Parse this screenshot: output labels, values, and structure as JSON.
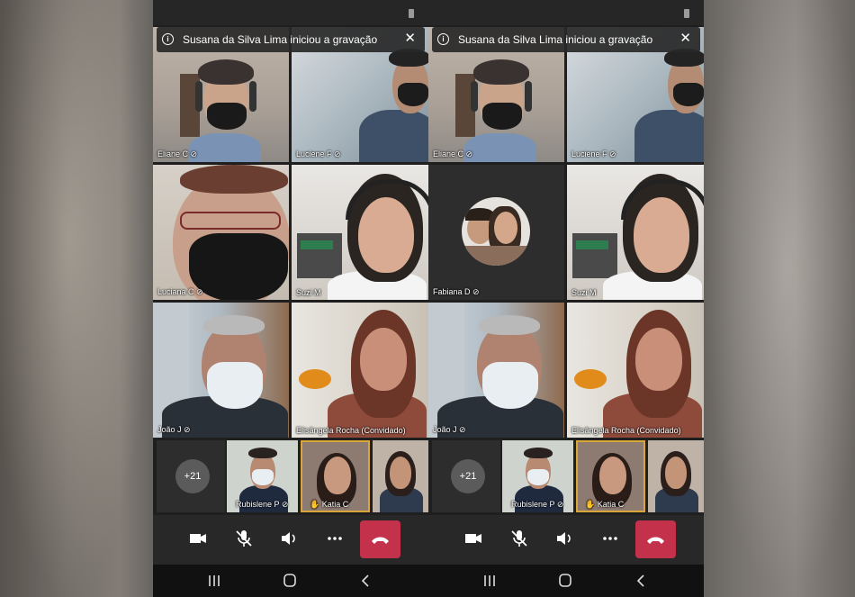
{
  "notice": "Susana da Silva Lima iniciou a gravação",
  "participants": {
    "eliane": "Eliane C",
    "luciene": "Luciene F",
    "luciana": "Luciana C",
    "suzi": "Suzi M",
    "fabiana": "Fabiana D",
    "joao": "João J",
    "elisangela": "Elisângela Rocha (Convidado)",
    "rubislene": "Rubislene P",
    "katia": "Katia C"
  },
  "overflow_count": "+21",
  "icons": {
    "info": "info-icon",
    "close": "close-icon",
    "camera": "camera-icon",
    "mic": "mic-off-icon",
    "speaker": "speaker-icon",
    "more": "more-icon",
    "hangup": "hangup-icon",
    "muted": "mic-off-icon",
    "raised_hand": "hand-icon",
    "nav_recent": "recent-apps-icon",
    "nav_home": "home-icon",
    "nav_back": "back-icon"
  },
  "colors": {
    "hangup": "#c4314b",
    "speaking_outline": "#d9a63a",
    "control_bar": "#282828"
  }
}
